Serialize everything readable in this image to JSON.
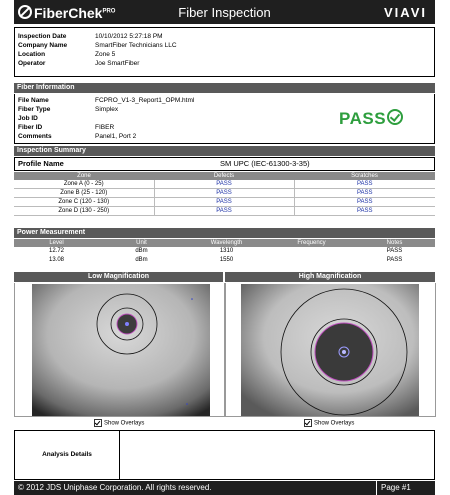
{
  "header": {
    "logo": "FiberChek",
    "logo_sup": "PRO",
    "title": "Fiber Inspection",
    "brand": "VIAVI"
  },
  "inspection": [
    {
      "label": "Inspection Date",
      "value": "10/10/2012 5:27:18 PM"
    },
    {
      "label": "Company Name",
      "value": "SmartFiber Technicians LLC"
    },
    {
      "label": "Location",
      "value": "Zone 5"
    },
    {
      "label": "Operator",
      "value": "Joe SmartFiber"
    }
  ],
  "fiber_info": {
    "heading": "Fiber Information",
    "rows": [
      {
        "label": "File Name",
        "value": "FCPRO_V1-3_Report1_OPM.html"
      },
      {
        "label": "Fiber Type",
        "value": "Simplex"
      },
      {
        "label": "Job ID",
        "value": ""
      },
      {
        "label": "Fiber ID",
        "value": "FIBER"
      },
      {
        "label": "Comments",
        "value": "Panel1, Port 2"
      }
    ],
    "result": "PASS",
    "result_color": "#2e9e3e"
  },
  "summary": {
    "heading": "Inspection Summary",
    "profile_label": "Profile Name",
    "profile_value": "SM UPC (IEC-61300-3-35)",
    "columns": [
      "Zone",
      "Defects",
      "Scratches"
    ],
    "rows": [
      {
        "zone": "Zone A (0 - 25)",
        "defects": "PASS",
        "scratches": "PASS"
      },
      {
        "zone": "Zone B (25 - 120)",
        "defects": "PASS",
        "scratches": "PASS"
      },
      {
        "zone": "Zone C (120 - 130)",
        "defects": "PASS",
        "scratches": "PASS"
      },
      {
        "zone": "Zone D (130 - 250)",
        "defects": "PASS",
        "scratches": "PASS"
      }
    ]
  },
  "power": {
    "heading": "Power Measurement",
    "columns": [
      "Level",
      "Unit",
      "Wavelength",
      "Frequency",
      "Notes"
    ],
    "rows": [
      {
        "level": "12.72",
        "unit": "dBm",
        "wavelength": "1310",
        "frequency": "",
        "notes": "PASS"
      },
      {
        "level": "13.08",
        "unit": "dBm",
        "wavelength": "1550",
        "frequency": "",
        "notes": "PASS"
      }
    ]
  },
  "magnification": {
    "low": {
      "heading": "Low Magnification",
      "overlay_label": "Show Overlays",
      "overlay_checked": true
    },
    "high": {
      "heading": "High Magnification",
      "overlay_label": "Show Overlays",
      "overlay_checked": true
    }
  },
  "analysis": {
    "label": "Analysis Details",
    "value": ""
  },
  "footer": {
    "copyright": "© 2012 JDS Uniphase Corporation. All rights reserved.",
    "page": "Page #1"
  }
}
